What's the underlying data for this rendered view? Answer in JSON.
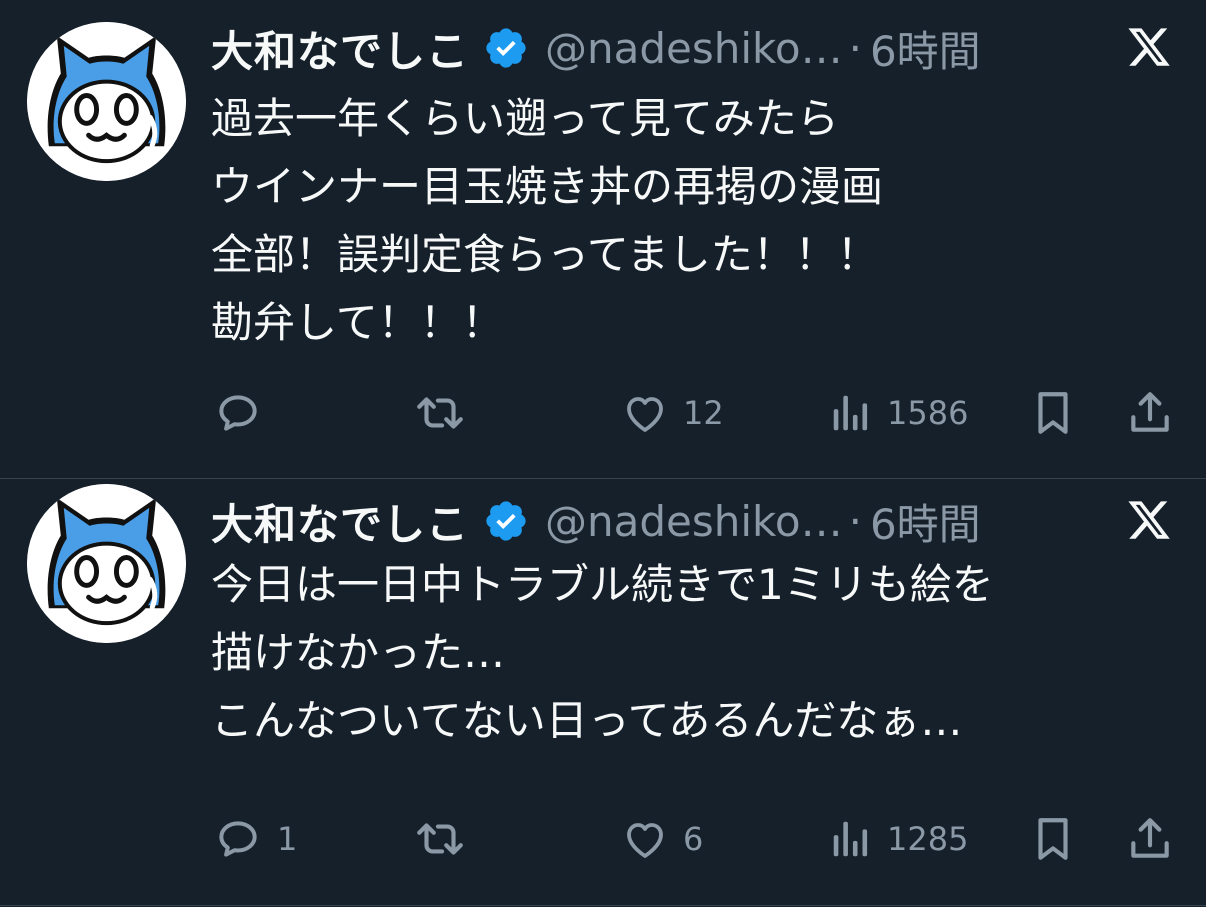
{
  "tweets": [
    {
      "display_name": "大和なでしこ",
      "handle": "@nadeshiko…",
      "separator": "·",
      "time": "6時間",
      "text_lines": [
        "過去一年くらい遡って見てみたら",
        "ウインナー目玉焼き丼の再掲の漫画",
        "全部！誤判定食らってました！！！",
        "勘弁して！！！"
      ],
      "replies": "",
      "retweets": "",
      "likes": "12",
      "views": "1586"
    },
    {
      "display_name": "大和なでしこ",
      "handle": "@nadeshiko…",
      "separator": "·",
      "time": "6時間",
      "text_lines": [
        "今日は一日中トラブル続きで1ミリも絵を",
        "描けなかった…",
        "こんなついてない日ってあるんだなぁ…"
      ],
      "replies": "1",
      "retweets": "",
      "likes": "6",
      "views": "1285"
    }
  ],
  "icons": {
    "avatar": "blue-cat-mascot-avatar",
    "verified": "verified-badge-icon",
    "platform": "x-logo-icon",
    "reply": "reply-icon",
    "retweet": "retweet-icon",
    "like": "heart-icon",
    "views": "views-bar-chart-icon",
    "bookmark": "bookmark-icon",
    "share": "share-icon"
  },
  "colors": {
    "background": "#15202b",
    "text_primary": "#f7f9f9",
    "text_secondary": "#8b98a5",
    "verified_blue": "#1d9bf0",
    "divider": "#38444d"
  }
}
